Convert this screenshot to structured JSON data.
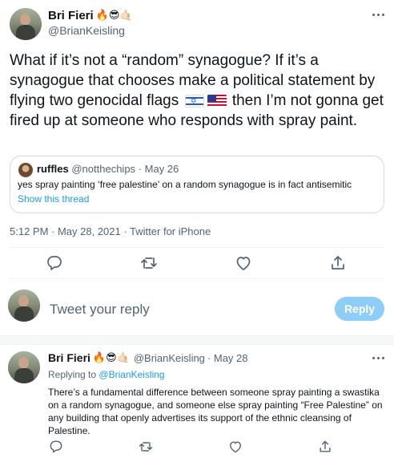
{
  "main_tweet": {
    "display_name": "Bri Fieri",
    "name_emojis": "🔥😎🤙🏻",
    "handle": "@BrianKeisling",
    "text_part1": "What if it’s not a “random” synagogue? If it’s a synagogue that chooses make a political statement by flying two genocidal flags",
    "text_part2": "then I’m not gonna get fired up at someone who responds with spray paint.",
    "flags": [
      "israel-flag-icon",
      "us-flag-icon"
    ],
    "quoted_tweet": {
      "display_name": "ruffles",
      "handle": "@notthechips",
      "date": "· May 26",
      "text": "yes spray painting ‘free palestine’ on a random synagogue is in fact antisemitic",
      "show_thread": "Show this thread"
    },
    "timestamp": "5:12 PM · May 28, 2021 · Twitter for iPhone"
  },
  "reply_composer": {
    "placeholder": "Tweet your reply",
    "reply_button": "Reply"
  },
  "reply_tweet": {
    "display_name": "Bri Fieri",
    "name_emojis": "🔥😎🤙🏻",
    "handle": "@BrianKeisling",
    "date": "· May 28",
    "replying_to_prefix": "Replying to",
    "replying_to_handle": "@BrianKeisling",
    "text": "There’s a fundamental difference between someone spray painting a swastika on a random synagogue, and someone else spray painting “Free Palestine” on any building that openly advertises its support of the ethnic cleansing of Palestine."
  },
  "action_icons": [
    "reply-icon",
    "retweet-icon",
    "like-icon",
    "share-icon"
  ],
  "colors": {
    "accent": "#1d9bf0",
    "reply_button_disabled": "#8ecdf8",
    "secondary_text": "#536471",
    "border": "#cfd9de"
  }
}
